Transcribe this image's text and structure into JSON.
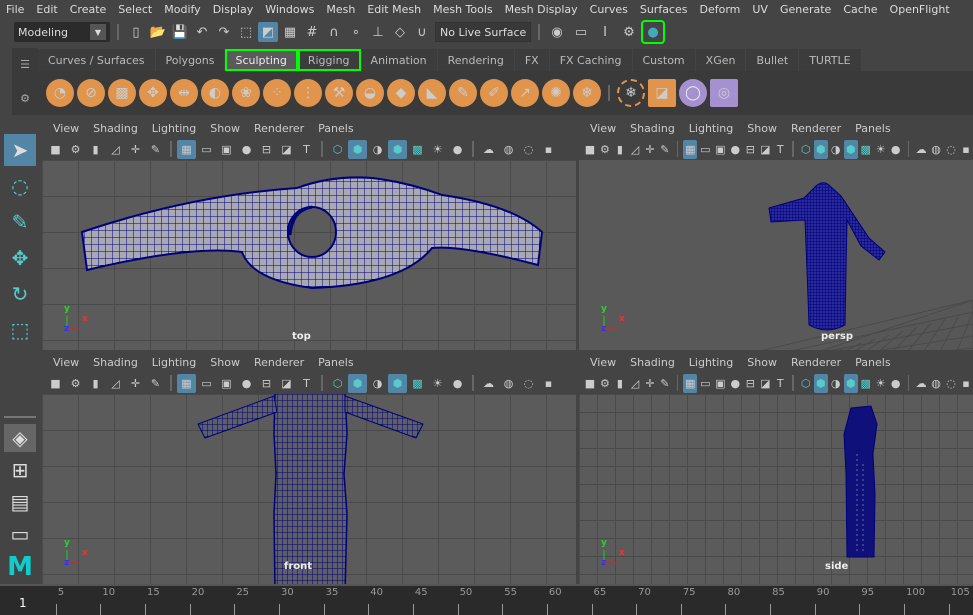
{
  "menubar": [
    "File",
    "Edit",
    "Create",
    "Select",
    "Modify",
    "Display",
    "Windows",
    "Mesh",
    "Edit Mesh",
    "Mesh Tools",
    "Mesh Display",
    "Curves",
    "Surfaces",
    "Deform",
    "UV",
    "Generate",
    "Cache",
    "OpenFlight"
  ],
  "status": {
    "mode": "Modeling",
    "live_surface": "No Live Surface",
    "icons": [
      "new-scene",
      "open-scene",
      "save-scene",
      "undo",
      "redo",
      "select-hierarchy",
      "select-object",
      "select-component",
      "snap-grid",
      "snap-curve",
      "snap-point",
      "snap-view-plane",
      "snap-live",
      "magnet"
    ],
    "render_icons": [
      "render-view",
      "render-current-frame",
      "ipr-render",
      "render-settings",
      "hypershade"
    ]
  },
  "shelf": {
    "tabs": [
      "Curves / Surfaces",
      "Polygons",
      "Sculpting",
      "Rigging",
      "Animation",
      "Rendering",
      "FX",
      "FX Caching",
      "Custom",
      "XGen",
      "Bullet",
      "TURTLE"
    ],
    "active": "Sculpting",
    "icons": [
      "sculpt-tool",
      "smooth-tool",
      "relax-tool",
      "grab-tool",
      "pinch-tool",
      "flatten-tool",
      "foamy-tool",
      "spray-tool",
      "repeat-tool",
      "imprint-tool",
      "wax-tool",
      "scrape-tool",
      "fill-tool",
      "knife-tool",
      "smear-tool",
      "bulge-tool",
      "amplify-tool",
      "freeze-tool",
      "convert-to-frozen",
      "mesh-display-settings",
      "sculpt-layer",
      "sculpt-layer-editor"
    ]
  },
  "toolbox": [
    "select-tool",
    "lasso-tool",
    "paint-select-tool",
    "move-tool",
    "rotate-tool",
    "scale-tool"
  ],
  "layouts": [
    "single-pane-layout",
    "four-pane-layout",
    "two-pane-layout",
    "outliner-layout"
  ],
  "viewport": {
    "menu": [
      "View",
      "Shading",
      "Lighting",
      "Show",
      "Renderer",
      "Panels"
    ]
  },
  "viewports": [
    {
      "camera": "top"
    },
    {
      "camera": "persp"
    },
    {
      "camera": "front"
    },
    {
      "camera": "side"
    }
  ],
  "axes": {
    "x": "x",
    "y": "y",
    "z": "z"
  },
  "timeline": {
    "current": "1",
    "ticks": [
      5,
      10,
      15,
      20,
      25,
      30,
      35,
      40,
      45,
      50,
      55,
      60,
      65,
      70,
      75,
      80,
      85,
      90,
      95,
      100,
      105
    ]
  },
  "colors": {
    "accent": "#5285a6",
    "shelf_orange": "#e0944c",
    "wire": "#00007a",
    "highlight": "#00ff00"
  }
}
